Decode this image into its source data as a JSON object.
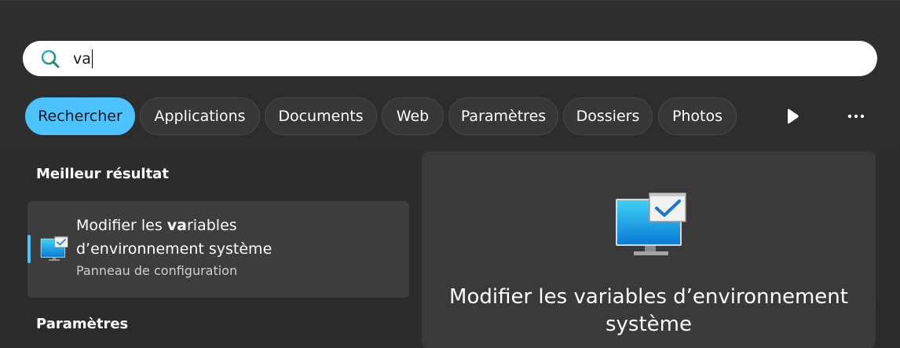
{
  "search": {
    "query": "va"
  },
  "filters": [
    {
      "label": "Rechercher",
      "active": true
    },
    {
      "label": "Applications",
      "active": false
    },
    {
      "label": "Documents",
      "active": false
    },
    {
      "label": "Web",
      "active": false
    },
    {
      "label": "Paramètres",
      "active": false
    },
    {
      "label": "Dossiers",
      "active": false
    },
    {
      "label": "Photos",
      "active": false
    }
  ],
  "toolbar": {
    "play_icon": "play-icon",
    "more_icon": "more-icon"
  },
  "best_result": {
    "heading": "Meilleur résultat",
    "title_line1_pre": "Modifier les ",
    "title_line1_bold": "va",
    "title_line1_post": "riables",
    "title_line2": "d’environnement système",
    "subtitle": "Panneau de configuration",
    "icon": "system-properties-icon"
  },
  "settings_section": {
    "heading": "Paramètres"
  },
  "preview": {
    "title": "Modifier les variables d’environnement système",
    "icon": "system-properties-icon"
  },
  "colors": {
    "accent": "#4cc2ff",
    "background": "#2b2b2b",
    "card": "#3d3d3d"
  }
}
